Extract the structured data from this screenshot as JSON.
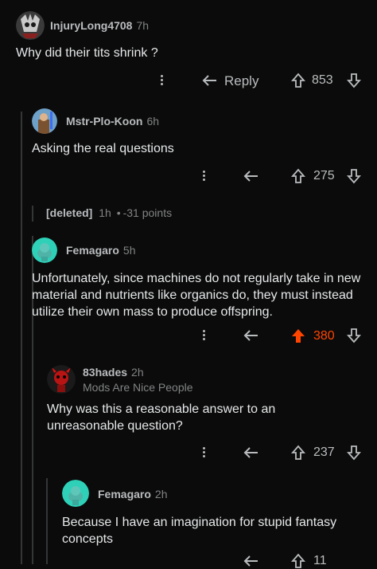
{
  "comments": [
    {
      "user": "InjuryLong4708",
      "time": "7h",
      "body": "Why did their tits shrink ?",
      "reply": "Reply",
      "votes": "853"
    },
    {
      "user": "Mstr-Plo-Koon",
      "time": "6h",
      "body": "Asking the real questions",
      "votes": "275"
    },
    {
      "deleted": "[deleted]",
      "time": "1h",
      "points": "-31 points"
    },
    {
      "user": "Femagaro",
      "time": "5h",
      "body": "Unfortunately, since machines do not regularly take in new material and nutrients like organics do, they must instead utilize their own mass to produce offspring.",
      "votes": "380"
    },
    {
      "user": "83hades",
      "time": "2h",
      "flair": "Mods Are Nice People",
      "body": "Why was this a reasonable answer to an unreasonable question?",
      "votes": "237"
    },
    {
      "user": "Femagaro",
      "time": "2h",
      "body": "Because I have an imagination for stupid fantasy concepts",
      "votes": "11"
    }
  ],
  "colors": {
    "upvoted": "#ff4500",
    "bg": "#0b0b0b",
    "thread_line": "#343536"
  }
}
